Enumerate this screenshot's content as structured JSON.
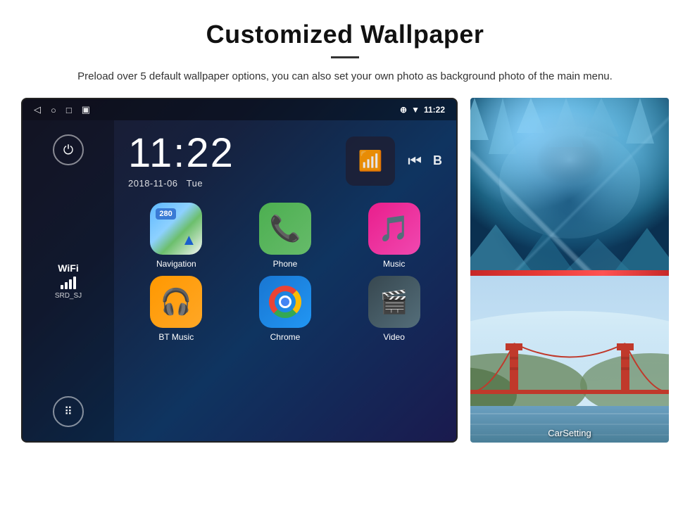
{
  "header": {
    "title": "Customized Wallpaper",
    "description": "Preload over 5 default wallpaper options, you can also set your own photo as background photo of the main menu."
  },
  "statusBar": {
    "time": "11:22",
    "navIcons": [
      "◁",
      "○",
      "□",
      "▣"
    ],
    "rightIcons": [
      "location",
      "wifi",
      "time"
    ]
  },
  "androidScreen": {
    "time": "11:22",
    "date": "2018-11-06",
    "day": "Tue",
    "sidebar": {
      "wifi_label": "WiFi",
      "wifi_ssid": "SRD_SJ"
    },
    "apps": [
      {
        "name": "Navigation",
        "badge": "280",
        "icon_type": "navigation"
      },
      {
        "name": "Phone",
        "icon_type": "phone"
      },
      {
        "name": "Music",
        "icon_type": "music"
      },
      {
        "name": "BT Music",
        "icon_type": "bt_music"
      },
      {
        "name": "Chrome",
        "icon_type": "chrome"
      },
      {
        "name": "Video",
        "icon_type": "video"
      }
    ]
  },
  "wallpapers": {
    "top_label": "Ice Cave",
    "bottom_label": "Golden Gate",
    "carsetting_label": "CarSetting"
  }
}
